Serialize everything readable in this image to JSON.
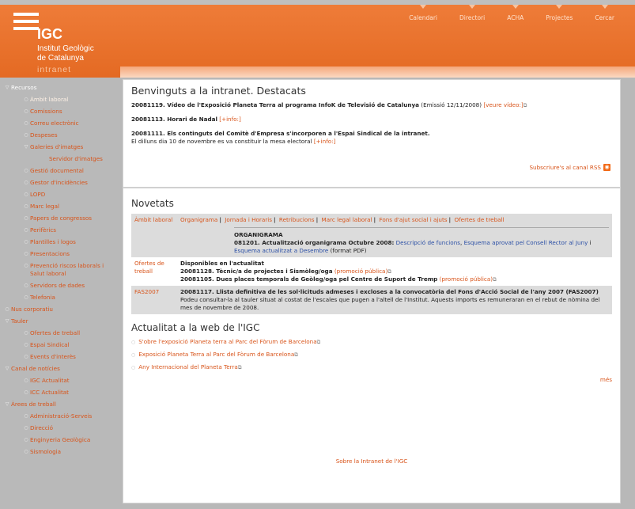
{
  "header": {
    "logo_acronym": "IGC",
    "logo_line1": "Institut Geològic",
    "logo_line2": "de Catalunya",
    "logo_intranet": "intranet",
    "topnav": [
      "Calendari",
      "Directori",
      "ACHA",
      "Projectes",
      "Cercar"
    ]
  },
  "sidebar": [
    {
      "label": "Recursos",
      "level": 0,
      "bullet": "▽",
      "state": "active"
    },
    {
      "label": "Àmbit laboral",
      "level": 1,
      "bullet": "○",
      "state": "sel"
    },
    {
      "label": "Comissions",
      "level": 1,
      "bullet": "○"
    },
    {
      "label": "Correu electrònic",
      "level": 1,
      "bullet": "○"
    },
    {
      "label": "Despeses",
      "level": 1,
      "bullet": "○"
    },
    {
      "label": "Galeries d'imatges",
      "level": 1,
      "bullet": "▽"
    },
    {
      "label": "Servidor d'imatges",
      "level": 2,
      "bullet": ""
    },
    {
      "label": "Gestió documental",
      "level": 1,
      "bullet": "○"
    },
    {
      "label": "Gestor d'incidències",
      "level": 1,
      "bullet": "○"
    },
    {
      "label": "LOPD",
      "level": 1,
      "bullet": "○"
    },
    {
      "label": "Marc legal",
      "level": 1,
      "bullet": "○"
    },
    {
      "label": "Papers de congressos",
      "level": 1,
      "bullet": "○"
    },
    {
      "label": "Perifèrics",
      "level": 1,
      "bullet": "○"
    },
    {
      "label": "Plantilles i logos",
      "level": 1,
      "bullet": "○"
    },
    {
      "label": "Presentacions",
      "level": 1,
      "bullet": "○"
    },
    {
      "label": "Prevenció riscos laborals i Salut laboral",
      "level": 1,
      "bullet": "○"
    },
    {
      "label": "Servidors de dades",
      "level": 1,
      "bullet": "○"
    },
    {
      "label": "Telefonia",
      "level": 1,
      "bullet": "○"
    },
    {
      "label": "Nus corporatiu",
      "level": 0,
      "bullet": "○"
    },
    {
      "label": "Tauler",
      "level": 0,
      "bullet": "▽"
    },
    {
      "label": "Ofertes de treball",
      "level": 1,
      "bullet": "○"
    },
    {
      "label": "Espai Sindical",
      "level": 1,
      "bullet": "○"
    },
    {
      "label": "Events d'interès",
      "level": 1,
      "bullet": "○"
    },
    {
      "label": "Canal de notícies",
      "level": 0,
      "bullet": "▽"
    },
    {
      "label": "IGC Actualitat",
      "level": 1,
      "bullet": "○"
    },
    {
      "label": "ICC Actualitat",
      "level": 1,
      "bullet": "○"
    },
    {
      "label": "Àrees de treball",
      "level": 0,
      "bullet": "▽"
    },
    {
      "label": "Administració-Serveis",
      "level": 1,
      "bullet": "○"
    },
    {
      "label": "Direcció",
      "level": 1,
      "bullet": "○"
    },
    {
      "label": "Enginyeria Geològica",
      "level": 1,
      "bullet": "○"
    },
    {
      "label": "Sismologia",
      "level": 1,
      "bullet": "○"
    }
  ],
  "highlights": {
    "title": "Benvinguts a la intranet. Destacats",
    "item1_bold": "20081119. Vídeo de l'Exposició Planeta Terra al programa InfoK de Televisió de Catalunya",
    "item1_rest": " (Emissió 12/11/2008) ",
    "item1_link": "[veure vídeo:]",
    "item2_bold": "20081113. Horari de Nadal",
    "item2_link": " [+info:]",
    "item3_bold": "20081111. Els continguts del Comitè d'Empresa s'incorporen a l'Espai Sindical de la intranet.",
    "item3_text": "El dilluns dia 10 de novembre es va constituir la mesa electoral ",
    "item3_link": "[+info:]",
    "rss": "Subscriure's al canal RSS"
  },
  "news": {
    "title": "Novetats",
    "row1_cat": "Àmbit laboral",
    "row1_tabs": [
      "Organigrama",
      "Jornada i Horaris",
      "Retribucions",
      "Marc legal laboral",
      "Fons d'ajut social i ajuts",
      "Ofertes de treball"
    ],
    "row1_head": "ORGANIGRAMA",
    "row1_bold": "081201. Actualització organigrama Octubre 2008:",
    "row1_l1": "Descripció de funcions",
    "row1_sep": ", ",
    "row1_l2": "Esquema aprovat pel Consell Rector al Juny",
    "row1_i": " i ",
    "row1_l3": "Esquema actualitzat a Desembre",
    "row1_end": " (format PDF)",
    "row2_cat": "Ofertes de treball",
    "row2_head": "Disponibles en l'actualitat",
    "row2_b1": "20081128. Tècnic/a de projectes i Sismòleg/oga",
    "row2_l1": "(promoció pública)",
    "row2_b2": "20081105. Dues places temporals de Geòleg/oga pel Centre de Suport de Tremp",
    "row2_l2": "(promoció pública)",
    "row3_cat": "FAS2007",
    "row3_bold": "20081117. Llista definitiva de les sol·licituds admeses i excloses a la convocatòria del Fons d'Acció Social de l'any 2007 (FAS2007)",
    "row3_text": "Podeu consultar-la al tauler situat al costat de l'escales que pugen a l'altell de l'Institut. Aquests imports es remuneraran en el rebut de nòmina del mes de novembre de 2008."
  },
  "web": {
    "title": "Actualitat a la web de l'IGC",
    "items": [
      "S'obre l'exposició Planeta terra al Parc del Fòrum de Barcelona",
      "Exposició Planeta Terra al Parc del Fòrum de Barcelona",
      "Any Internacional del Planeta Terra"
    ],
    "more": "més"
  },
  "footer": "Sobre la Intranet de l'IGC"
}
